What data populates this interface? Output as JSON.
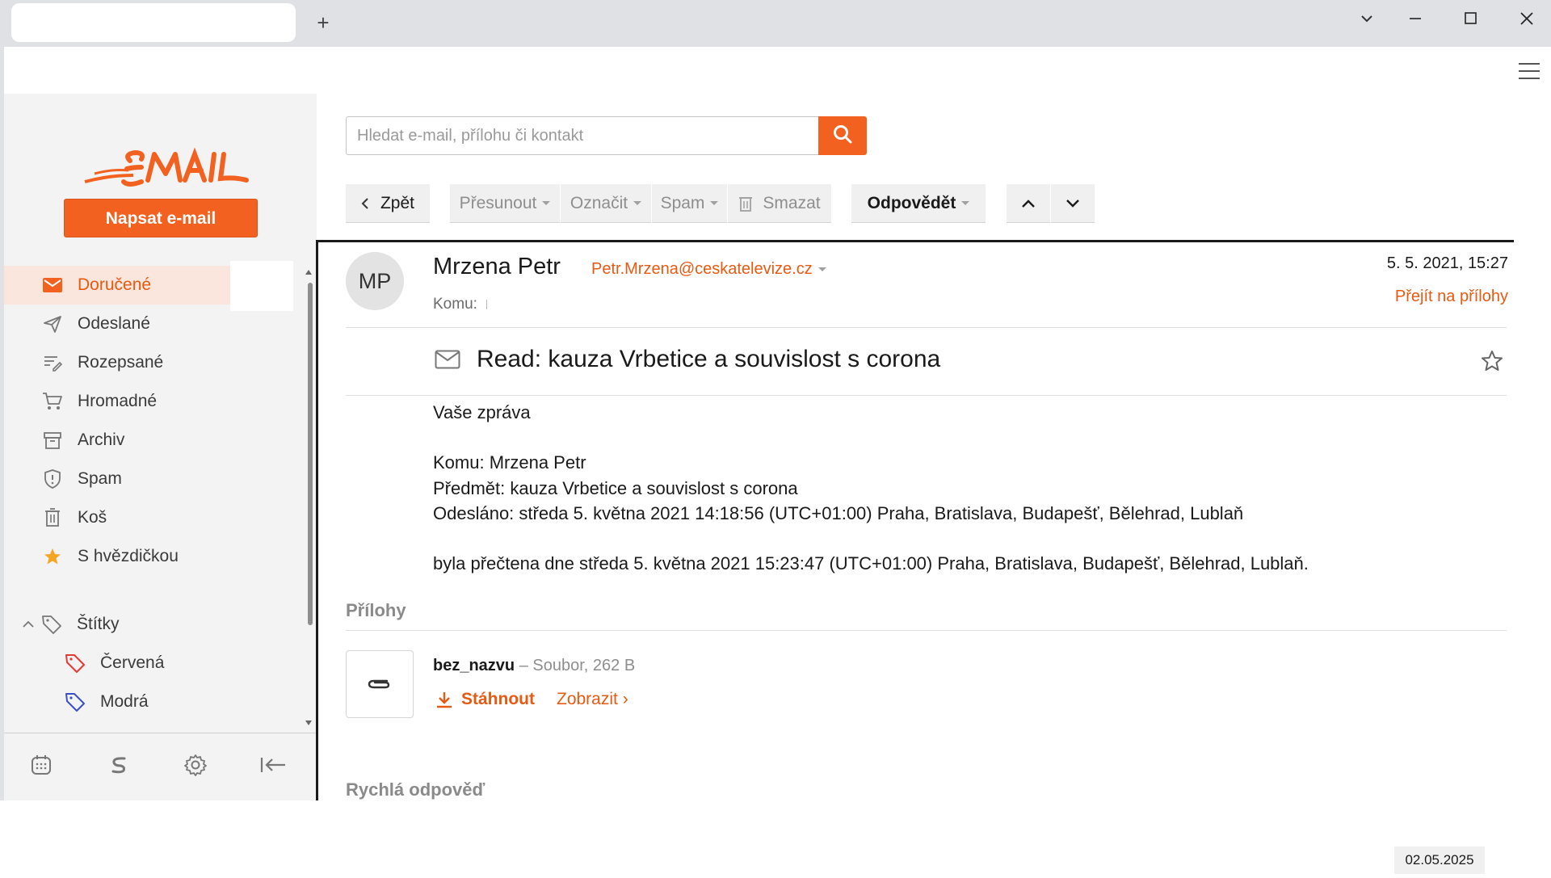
{
  "browser": {
    "new_tab": "+"
  },
  "search": {
    "placeholder": "Hledat e-mail, přílohu či kontakt"
  },
  "sidebar": {
    "logo_text": "EMAIL",
    "compose_label": "Napsat e-mail",
    "folders": [
      {
        "label": "Doručené",
        "icon": "inbox-icon"
      },
      {
        "label": "Odeslané",
        "icon": "send-icon"
      },
      {
        "label": "Rozepsané",
        "icon": "draft-icon"
      },
      {
        "label": "Hromadné",
        "icon": "cart-icon"
      },
      {
        "label": "Archiv",
        "icon": "archive-icon"
      },
      {
        "label": "Spam",
        "icon": "shield-icon"
      },
      {
        "label": "Koš",
        "icon": "trash-icon"
      },
      {
        "label": "S hvězdičkou",
        "icon": "star-icon"
      }
    ],
    "labels_header": "Štítky",
    "labels": [
      {
        "label": "Červená",
        "color": "#e53935"
      },
      {
        "label": "Modrá",
        "color": "#3a4fc4"
      }
    ]
  },
  "toolbar": {
    "back": "Zpět",
    "move": "Přesunout",
    "mark": "Označit",
    "spam": "Spam",
    "delete": "Smazat",
    "reply": "Odpovědět"
  },
  "message": {
    "avatar_initials": "MP",
    "sender_name": "Mrzena Petr",
    "sender_email": "Petr.Mrzena@ceskatelevize.cz",
    "to_label": "Komu:",
    "date": "5. 5. 2021, 15:27",
    "goto_attachments": "Přejít na přílohy",
    "subject": "Read: kauza Vrbetice a souvislost s corona",
    "body": [
      "Vaše zpráva",
      "Komu: Mrzena Petr",
      "Předmět: kauza Vrbetice a souvislost s corona",
      "Odesláno: středa 5. května 2021 14:18:56 (UTC+01:00) Praha, Bratislava, Budapešť, Bělehrad, Lublaň",
      "byla přečtena dne středa 5. května 2021 15:23:47 (UTC+01:00) Praha, Bratislava, Budapešť, Bělehrad, Lublaň."
    ]
  },
  "attachments": {
    "title": "Přílohy",
    "file_name": "bez_nazvu",
    "file_meta": "– Soubor, 262 B",
    "download": "Stáhnout",
    "view": "Zobrazit ›"
  },
  "quick_reply": {
    "title": "Rychlá odpověď"
  },
  "taskbar": {
    "date": "02.05.2025"
  },
  "colors": {
    "accent": "#f2611f",
    "accent_text": "#e85a12"
  }
}
